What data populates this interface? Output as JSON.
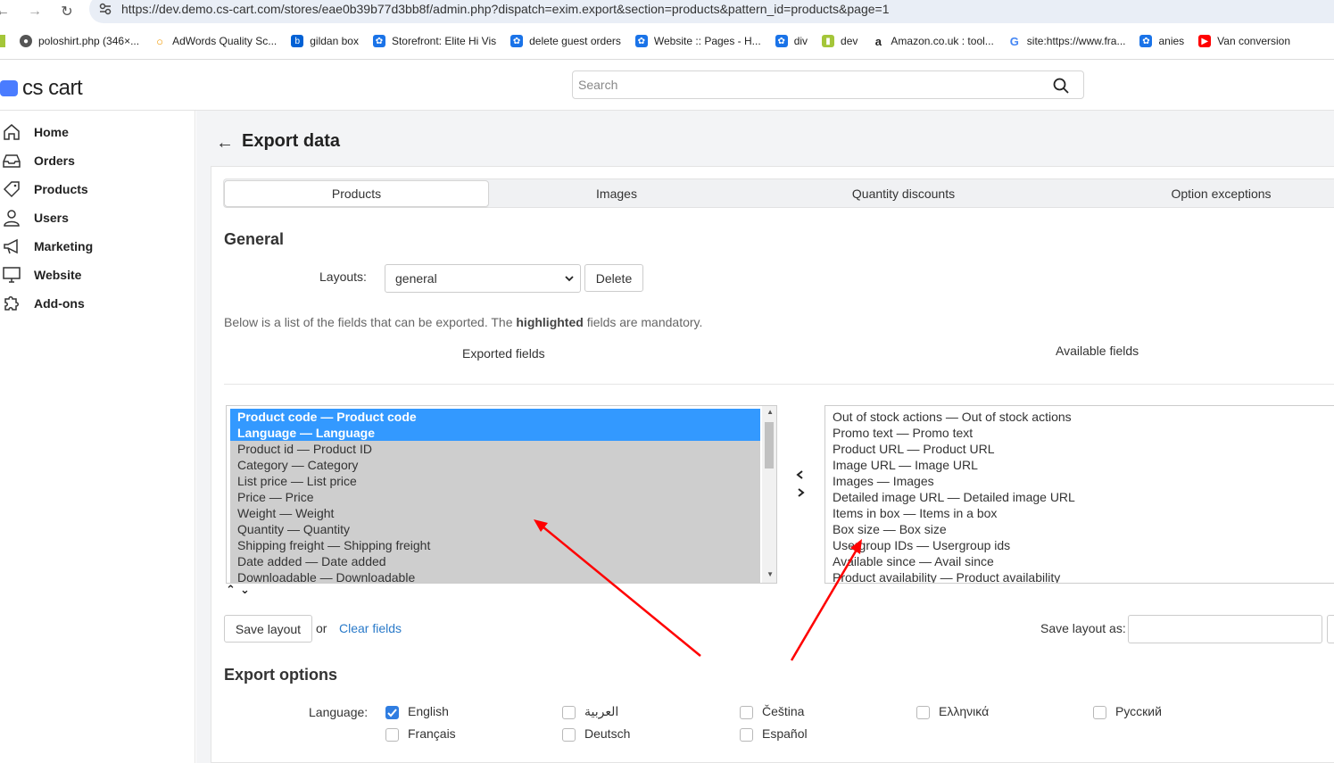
{
  "browser": {
    "url": "https://dev.demo.cs-cart.com/stores/eae0b39b77d3bb8f/admin.php?dispatch=exim.export&section=products&pattern_id=products&page=1",
    "bookmarks": [
      {
        "label": "poloshirt.php (346×...",
        "icon": "globe-icon",
        "color": "#555555"
      },
      {
        "label": "AdWords Quality Sc...",
        "icon": "circle-icon",
        "color": "#f29900"
      },
      {
        "label": "gildan box",
        "icon": "box-icon",
        "color": "#0061d5"
      },
      {
        "label": "Storefront: Elite Hi Vis",
        "icon": "gear-icon",
        "color": "#1a73e8"
      },
      {
        "label": "delete guest orders",
        "icon": "gear-icon",
        "color": "#1a73e8"
      },
      {
        "label": "Website :: Pages - H...",
        "icon": "gear-icon",
        "color": "#1a73e8"
      },
      {
        "label": "div",
        "icon": "gear-icon",
        "color": "#1a73e8"
      },
      {
        "label": "dev",
        "icon": "android-icon",
        "color": "#a4c639"
      },
      {
        "label": "Amazon.co.uk : tool...",
        "icon": "amazon-icon",
        "color": "#222222"
      },
      {
        "label": "site:https://www.fra...",
        "icon": "google-icon",
        "color": "#4285f4"
      },
      {
        "label": "anies",
        "icon": "gear-icon",
        "color": "#1a73e8"
      },
      {
        "label": "Van conversion",
        "icon": "youtube-icon",
        "color": "#ff0000"
      }
    ]
  },
  "app": {
    "logo": "cs cart",
    "search_placeholder": "Search"
  },
  "sidebar": {
    "items": [
      {
        "label": "Home",
        "icon": "home-icon"
      },
      {
        "label": "Orders",
        "icon": "inbox-icon"
      },
      {
        "label": "Products",
        "icon": "tag-icon"
      },
      {
        "label": "Users",
        "icon": "user-icon"
      },
      {
        "label": "Marketing",
        "icon": "megaphone-icon"
      },
      {
        "label": "Website",
        "icon": "monitor-icon"
      },
      {
        "label": "Add-ons",
        "icon": "puzzle-icon"
      }
    ]
  },
  "page": {
    "title": "Export data",
    "tabs": [
      "Products",
      "Images",
      "Quantity discounts",
      "Option exceptions"
    ],
    "active_tab": "Products"
  },
  "general": {
    "title": "General",
    "layouts_label": "Layouts:",
    "layout_value": "general",
    "delete_label": "Delete",
    "desc_before": "Below is a list of the fields that can be exported. The ",
    "desc_bold": "highlighted",
    "desc_after": " fields are mandatory.",
    "exported_head": "Exported fields",
    "available_head": "Available fields",
    "exported_fields": [
      {
        "text": "Product code — Product code",
        "mandatory": true
      },
      {
        "text": "Language — Language",
        "mandatory": true
      },
      {
        "text": "Product id — Product ID",
        "mandatory": false
      },
      {
        "text": "Category — Category",
        "mandatory": false
      },
      {
        "text": "List price — List price",
        "mandatory": false
      },
      {
        "text": "Price — Price",
        "mandatory": false
      },
      {
        "text": "Weight — Weight",
        "mandatory": false
      },
      {
        "text": "Quantity — Quantity",
        "mandatory": false
      },
      {
        "text": "Shipping freight — Shipping freight",
        "mandatory": false
      },
      {
        "text": "Date added — Date added",
        "mandatory": false
      },
      {
        "text": "Downloadable — Downloadable",
        "mandatory": false
      }
    ],
    "available_fields": [
      "Out of stock actions — Out of stock actions",
      "Promo text — Promo text",
      "Product URL — Product URL",
      "Image URL — Image URL",
      "Images — Images",
      "Detailed image URL — Detailed image URL",
      "Items in box — Items in a box",
      "Box size — Box size",
      "Usergroup IDs — Usergroup ids",
      "Available since — Avail since",
      "Product availability — Product availability"
    ],
    "save_layout_label": "Save layout",
    "or_label": "or",
    "clear_fields_label": "Clear fields",
    "save_layout_as_label": "Save layout as:"
  },
  "export_options": {
    "title": "Export options",
    "language_label": "Language:",
    "languages": [
      {
        "label": "English",
        "checked": true
      },
      {
        "label": "العربية",
        "checked": false
      },
      {
        "label": "Čeština",
        "checked": false
      },
      {
        "label": "Ελληνικά",
        "checked": false
      },
      {
        "label": "Русский",
        "checked": false
      },
      {
        "label": "Français",
        "checked": false
      },
      {
        "label": "Deutsch",
        "checked": false
      },
      {
        "label": "Español",
        "checked": false
      }
    ]
  },
  "colors": {
    "accent": "#3399ff",
    "link": "#2a7ac9",
    "annotation_arrow": "#ff0000",
    "checkbox_checked": "#2f7de1"
  }
}
